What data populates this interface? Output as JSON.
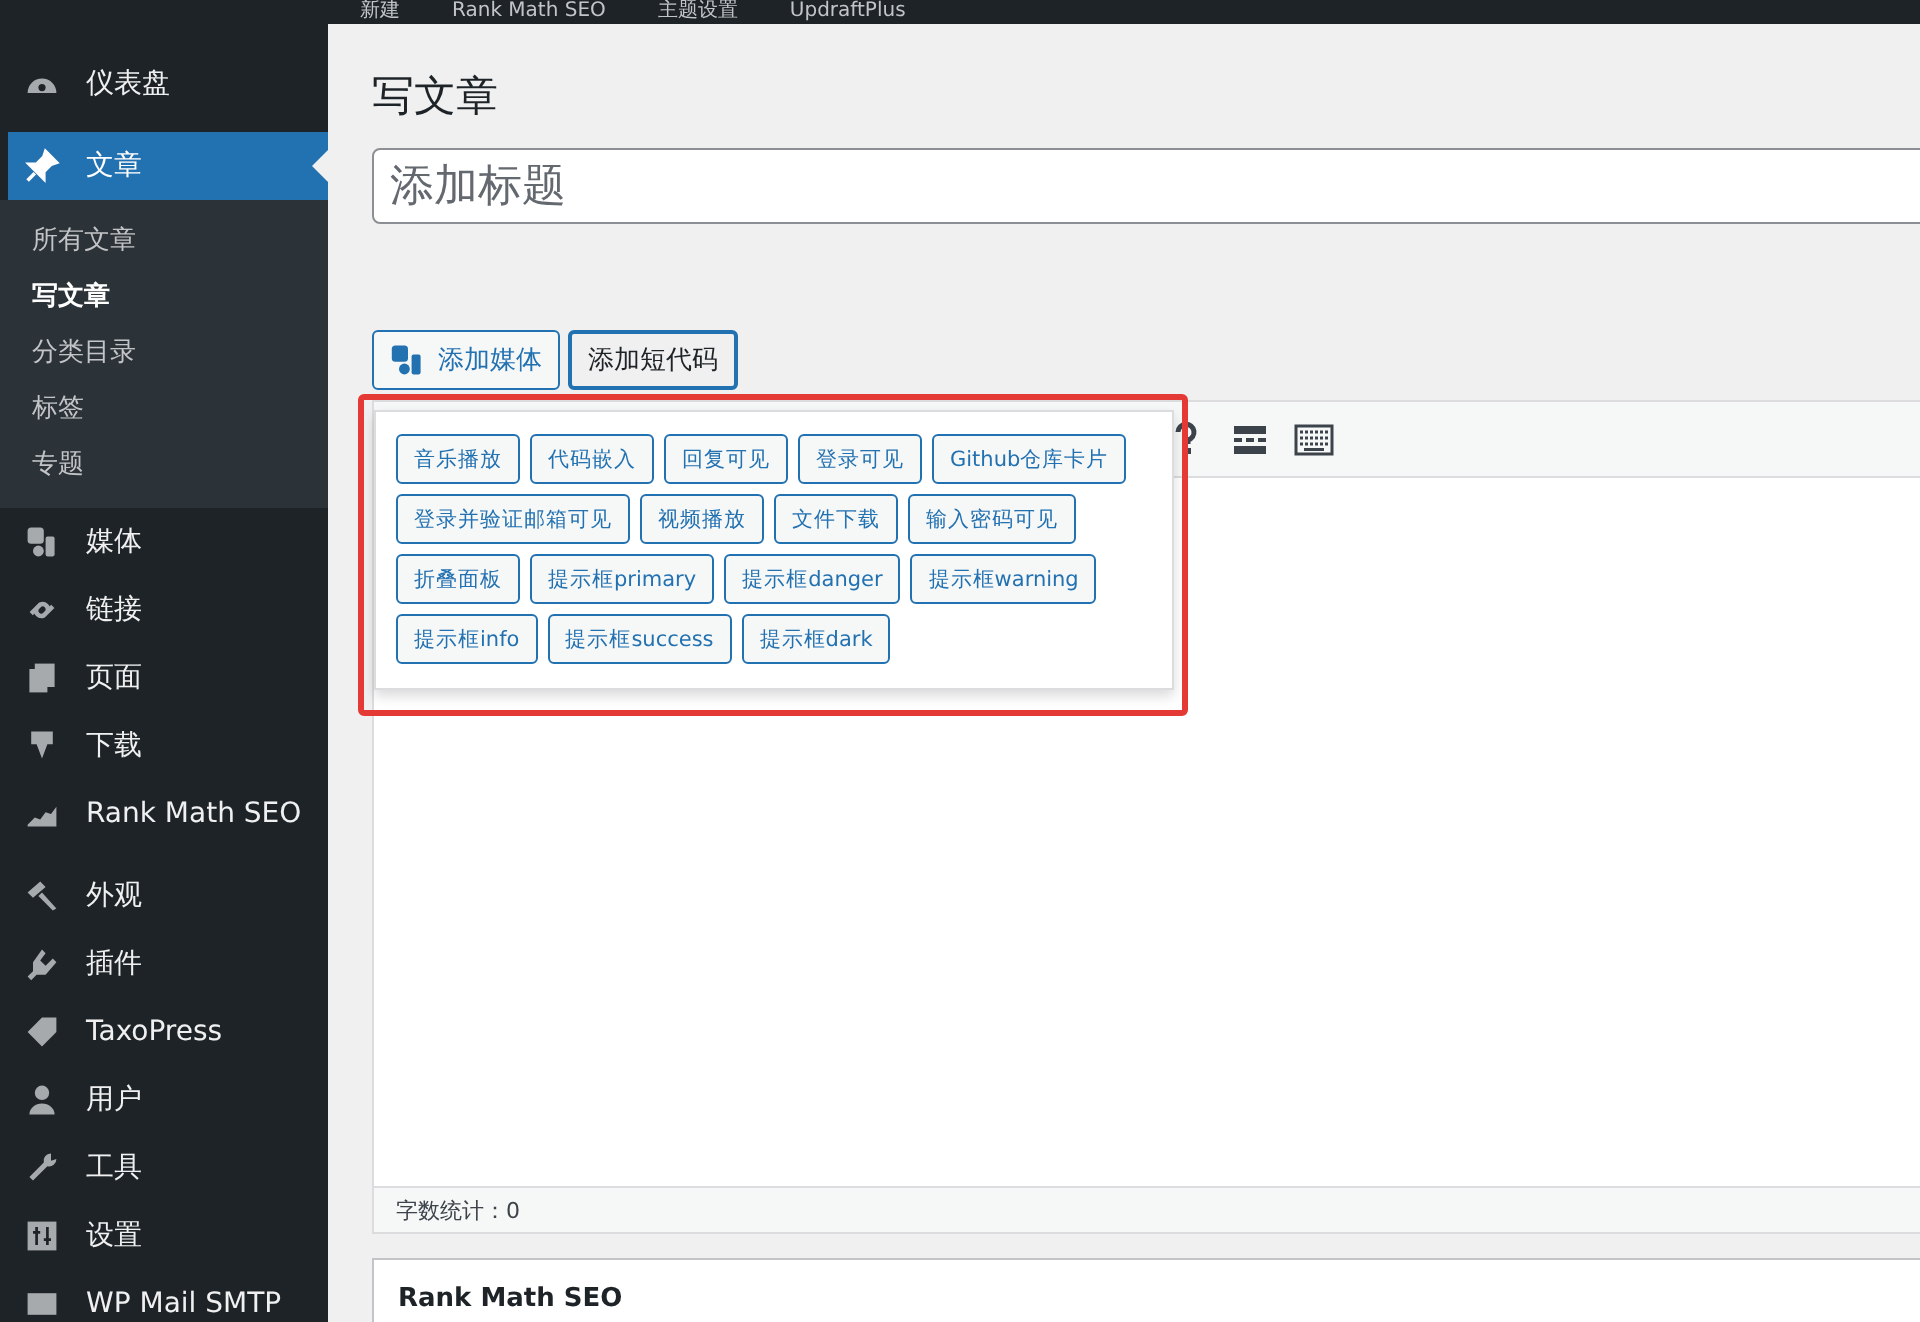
{
  "admin_bar": {
    "items": [
      "新建",
      "Rank Math SEO",
      "主题设置",
      "UpdraftPlus"
    ]
  },
  "sidebar": {
    "items": [
      {
        "label": "仪表盘",
        "selected": false,
        "separator_after": true
      },
      {
        "label": "文章",
        "selected": true,
        "separator_after": false,
        "children": [
          {
            "label": "所有文章",
            "selected": false
          },
          {
            "label": "写文章",
            "selected": true
          },
          {
            "label": "分类目录",
            "selected": false
          },
          {
            "label": "标签",
            "selected": false
          },
          {
            "label": "专题",
            "selected": false
          }
        ]
      },
      {
        "label": "媒体",
        "selected": false,
        "separator_after": false
      },
      {
        "label": "链接",
        "selected": false,
        "separator_after": false
      },
      {
        "label": "页面",
        "selected": false,
        "separator_after": false
      },
      {
        "label": "下载",
        "selected": false,
        "separator_after": false
      },
      {
        "label": "Rank Math SEO",
        "selected": false,
        "separator_after": true
      },
      {
        "label": "外观",
        "selected": false,
        "separator_after": false
      },
      {
        "label": "插件",
        "selected": false,
        "separator_after": false
      },
      {
        "label": "TaxoPress",
        "selected": false,
        "separator_after": false
      },
      {
        "label": "用户",
        "selected": false,
        "separator_after": false
      },
      {
        "label": "工具",
        "selected": false,
        "separator_after": false
      },
      {
        "label": "设置",
        "selected": false,
        "separator_after": false
      },
      {
        "label": "WP Mail SMTP",
        "selected": false,
        "separator_after": false
      }
    ]
  },
  "page": {
    "title": "写文章",
    "title_field": {
      "placeholder": "添加标题"
    },
    "buttons": [
      {
        "label": "添加媒体",
        "kind": "media",
        "selected": false
      },
      {
        "label": "添加短代码",
        "kind": "plain",
        "selected": true
      }
    ],
    "shortcode_menu": {
      "items": [
        "音乐播放",
        "代码嵌入",
        "回复可见",
        "登录可见",
        "Github仓库卡片",
        "登录并验证邮箱可见",
        "视频播放",
        "文件下载",
        "输入密码可见",
        "折叠面板",
        "提示框primary",
        "提示框danger",
        "提示框warning",
        "提示框info",
        "提示框success",
        "提示框dark"
      ]
    },
    "word_count": "字数统计：0",
    "panels": [
      {
        "title": "Rank Math SEO"
      }
    ]
  }
}
